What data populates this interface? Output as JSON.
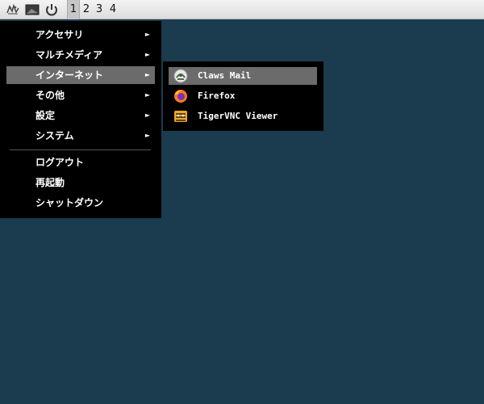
{
  "taskbar": {
    "icons": [
      "app-menu-icon",
      "show-desktop-icon",
      "power-icon"
    ],
    "workspaces": [
      "1",
      "2",
      "3",
      "4"
    ],
    "active_workspace": "1"
  },
  "main_menu": {
    "items": [
      {
        "label": "アクセサリ",
        "submenu": true
      },
      {
        "label": "マルチメディア",
        "submenu": true
      },
      {
        "label": "インターネット",
        "submenu": true,
        "highlighted": true
      },
      {
        "label": "その他",
        "submenu": true
      },
      {
        "label": "設定",
        "submenu": true
      },
      {
        "label": "システム",
        "submenu": true
      }
    ],
    "actions": [
      {
        "label": "ログアウト"
      },
      {
        "label": "再起動"
      },
      {
        "label": "シャットダウン"
      }
    ],
    "arrow": "►"
  },
  "internet_submenu": {
    "items": [
      {
        "label": "Claws Mail",
        "icon": "claws-mail-icon",
        "highlighted": true
      },
      {
        "label": "Firefox",
        "icon": "firefox-icon"
      },
      {
        "label": "TigerVNC Viewer",
        "icon": "tigervnc-icon"
      }
    ]
  },
  "colors": {
    "desktop": "#1a3c4e",
    "menu_bg": "#000000",
    "highlight": "#6b6b6b"
  }
}
